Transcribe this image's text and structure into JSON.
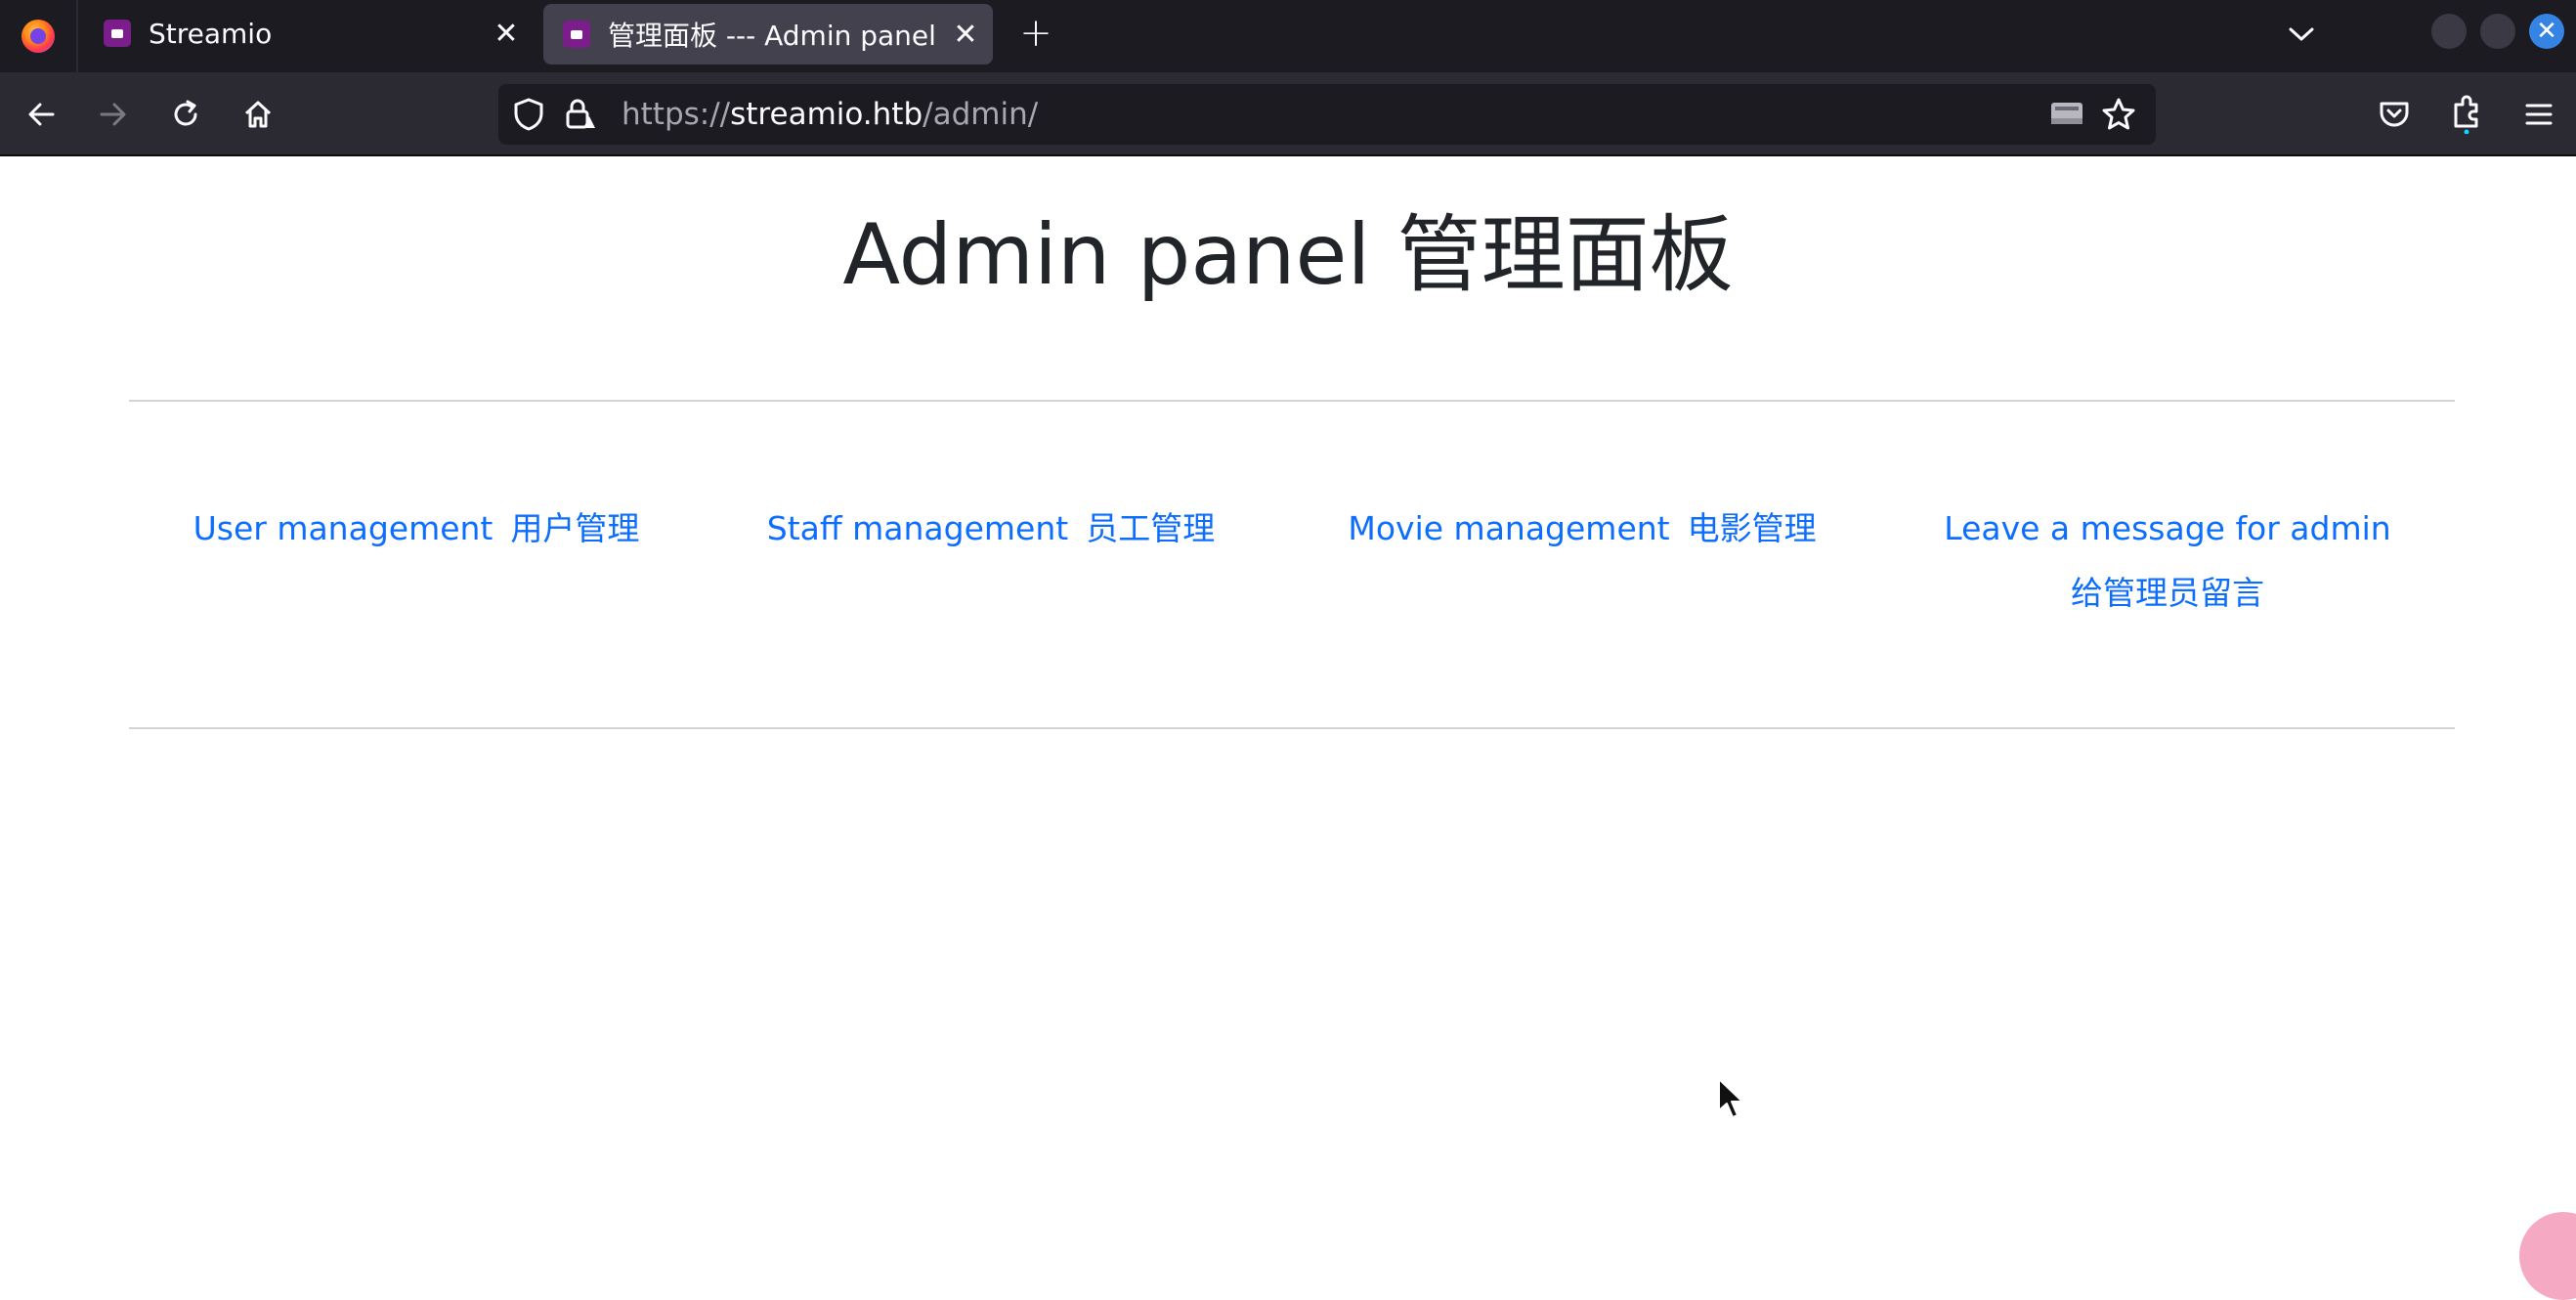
{
  "browser": {
    "tabs": [
      {
        "title": "Streamio",
        "active": false
      },
      {
        "title": "管理面板 --- Admin panel",
        "active": true
      }
    ],
    "url": {
      "scheme": "https://",
      "host": "streamio.htb",
      "path": "/admin/"
    },
    "icons": {
      "back": "back-arrow-icon",
      "forward": "forward-arrow-icon",
      "reload": "reload-icon",
      "home": "home-icon",
      "shield": "tracking-protection-shield-icon",
      "lock": "insecure-lock-icon",
      "reader": "reader-view-icon",
      "bookmark": "bookmark-star-icon",
      "pocket": "pocket-icon",
      "extensions": "extensions-icon",
      "menu": "hamburger-menu-icon"
    }
  },
  "page": {
    "title": "Admin panel 管理面板",
    "links": [
      {
        "en": "User management",
        "zh": "用户管理"
      },
      {
        "en": "Staff management",
        "zh": "员工管理"
      },
      {
        "en": "Movie management",
        "zh": "电影管理"
      },
      {
        "en": "Leave a message for admin",
        "zh": "给管理员留言"
      }
    ]
  },
  "colors": {
    "link": "#0d6efd",
    "heading": "#212529",
    "tabstrip": "#1c1b22",
    "toolbar": "#2b2a33"
  }
}
